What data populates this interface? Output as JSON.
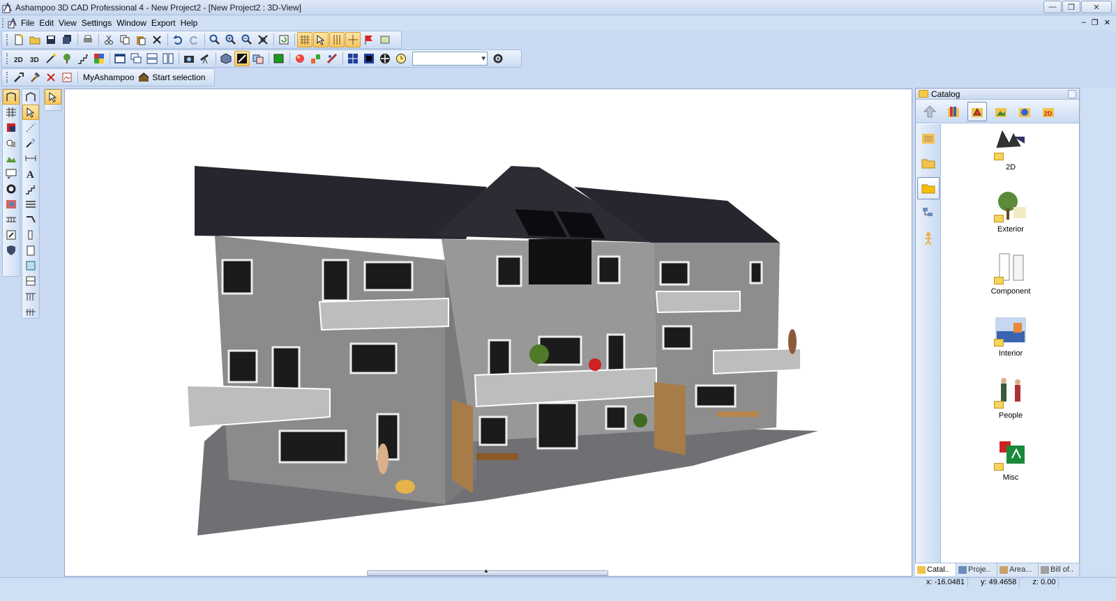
{
  "window": {
    "title": "Ashampoo 3D CAD Professional 4 - New Project2 - [New Project2 : 3D-View]"
  },
  "menu": {
    "items": [
      {
        "label": "File"
      },
      {
        "label": "Edit"
      },
      {
        "label": "View"
      },
      {
        "label": "Settings"
      },
      {
        "label": "Window"
      },
      {
        "label": "Export"
      },
      {
        "label": "Help"
      }
    ]
  },
  "toolbar3": {
    "myashampoo_label": "MyAshampoo",
    "start_selection_label": "Start selection"
  },
  "catalog": {
    "title": "Catalog",
    "items": [
      {
        "label": "2D",
        "icon": "2d-people-icon"
      },
      {
        "label": "Exterior",
        "icon": "exterior-tree-icon"
      },
      {
        "label": "Component",
        "icon": "component-door-icon"
      },
      {
        "label": "Interior",
        "icon": "interior-room-icon"
      },
      {
        "label": "People",
        "icon": "people-icon"
      },
      {
        "label": "Misc",
        "icon": "misc-sign-icon"
      }
    ],
    "tabs": [
      {
        "label": "Catal..",
        "active": true
      },
      {
        "label": "Proje..",
        "active": false
      },
      {
        "label": "Area...",
        "active": false
      },
      {
        "label": "Bill of..",
        "active": false
      }
    ]
  },
  "status": {
    "x": "x: -16.0481",
    "y": "y: 49.4658",
    "z": "z: 0.00"
  },
  "colors": {
    "roof": "#26262e",
    "wall": "#8e8e8e",
    "accent": "#f7c760"
  }
}
